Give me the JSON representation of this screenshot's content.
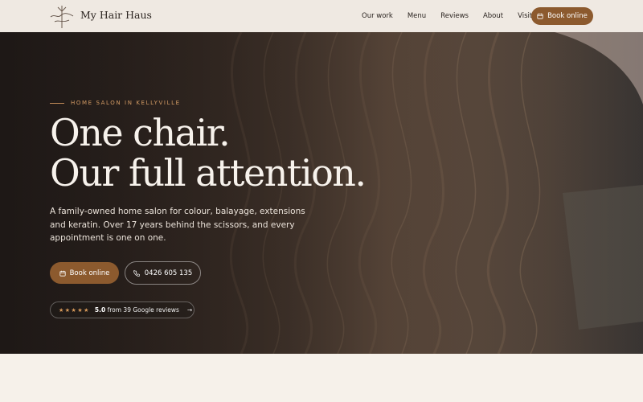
{
  "header": {
    "brand": "My Hair Haus",
    "nav": [
      "Our work",
      "Menu",
      "Reviews",
      "About",
      "Visit"
    ],
    "book_label": "Book online"
  },
  "hero": {
    "eyebrow": "HOME SALON IN KELLYVILLE",
    "headline_line1": "One chair.",
    "headline_line2": "Our full attention.",
    "lede": "A family-owned home salon for colour, balayage, extensions and keratin. Over 17 years behind the scissors, and every appointment is one on one.",
    "book_label": "Book online",
    "phone_label": "0426 605 135",
    "stars": "★★★★★",
    "rating": "5.0",
    "reviews_text": "from 39 Google reviews",
    "arrow": "→"
  },
  "colors": {
    "accent": "#8c5a2e",
    "eyebrow": "#d39b64",
    "header_bg": "#efe9e2",
    "page_bg": "#f6f1ea"
  },
  "icons": [
    "calendar-icon",
    "phone-icon",
    "star-icon",
    "arrow-right-icon",
    "logo-icon"
  ]
}
